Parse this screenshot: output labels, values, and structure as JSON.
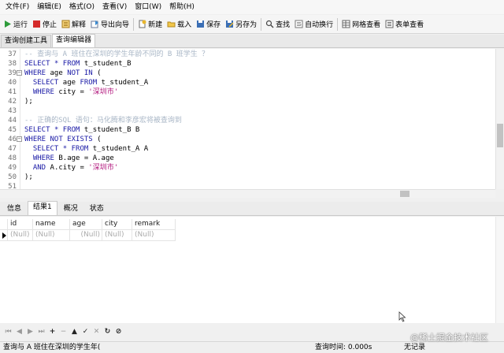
{
  "menu": [
    "文件(F)",
    "编辑(E)",
    "格式(O)",
    "查看(V)",
    "窗口(W)",
    "帮助(H)"
  ],
  "toolbar": {
    "run": "运行",
    "stop": "停止",
    "explain": "解释",
    "export_wizard": "导出向导",
    "new": "新建",
    "load": "载入",
    "save": "保存",
    "save_as": "另存为",
    "find": "查找",
    "word_wrap": "自动换行",
    "grid_view": "网格查看",
    "form_view": "表单查看"
  },
  "editor_tabs": [
    "查询创建工具",
    "查询编辑器"
  ],
  "code_lines": [
    {
      "n": "37",
      "fold": false,
      "text": "-- 查询与 A 班住在深圳的学生年龄不同的 B 班学生 ？"
    },
    {
      "n": "38",
      "fold": false,
      "text": "SELECT * FROM t_student_B"
    },
    {
      "n": "39",
      "fold": true,
      "text": "WHERE age NOT IN ("
    },
    {
      "n": "40",
      "fold": false,
      "text": "  SELECT age FROM t_student_A"
    },
    {
      "n": "41",
      "fold": false,
      "text": "  WHERE city = '深圳市'"
    },
    {
      "n": "42",
      "fold": false,
      "text": ");"
    },
    {
      "n": "43",
      "fold": false,
      "text": ""
    },
    {
      "n": "44",
      "fold": false,
      "text": "-- 正确的SQL 语句：马化腾和李彦宏将被查询到"
    },
    {
      "n": "45",
      "fold": false,
      "text": "SELECT * FROM t_student_B B"
    },
    {
      "n": "46",
      "fold": true,
      "text": "WHERE NOT EXISTS ("
    },
    {
      "n": "47",
      "fold": false,
      "text": "  SELECT * FROM t_student_A A"
    },
    {
      "n": "48",
      "fold": false,
      "text": "  WHERE B.age = A.age"
    },
    {
      "n": "49",
      "fold": false,
      "text": "  AND A.city = '深圳市'"
    },
    {
      "n": "50",
      "fold": false,
      "text": ");"
    },
    {
      "n": "51",
      "fold": false,
      "text": ""
    }
  ],
  "result_tabs": [
    "信息",
    "结果1",
    "概况",
    "状态"
  ],
  "result_columns": [
    "id",
    "name",
    "age",
    "city",
    "remark"
  ],
  "result_rows": [
    [
      "(Null)",
      "(Null)",
      "(Null)",
      "(Null)",
      "(Null)"
    ]
  ],
  "nav_buttons": [
    "first-icon",
    "prev-icon",
    "next-icon",
    "last-icon",
    "add-icon",
    "delete-icon",
    "apply-icon",
    "discard-icon",
    "cancel-icon",
    "refresh-icon",
    "stop-icon"
  ],
  "status": {
    "query_label": "查询与 A 班住在深圳的学生年(",
    "time": "查询时间: 0.000s",
    "records": "无记录"
  },
  "watermark": "@稀土掘金技术社区",
  "colors": {
    "keyword": "#1a1aa6",
    "string": "#b0127a",
    "comment": "#a8b6c6"
  }
}
